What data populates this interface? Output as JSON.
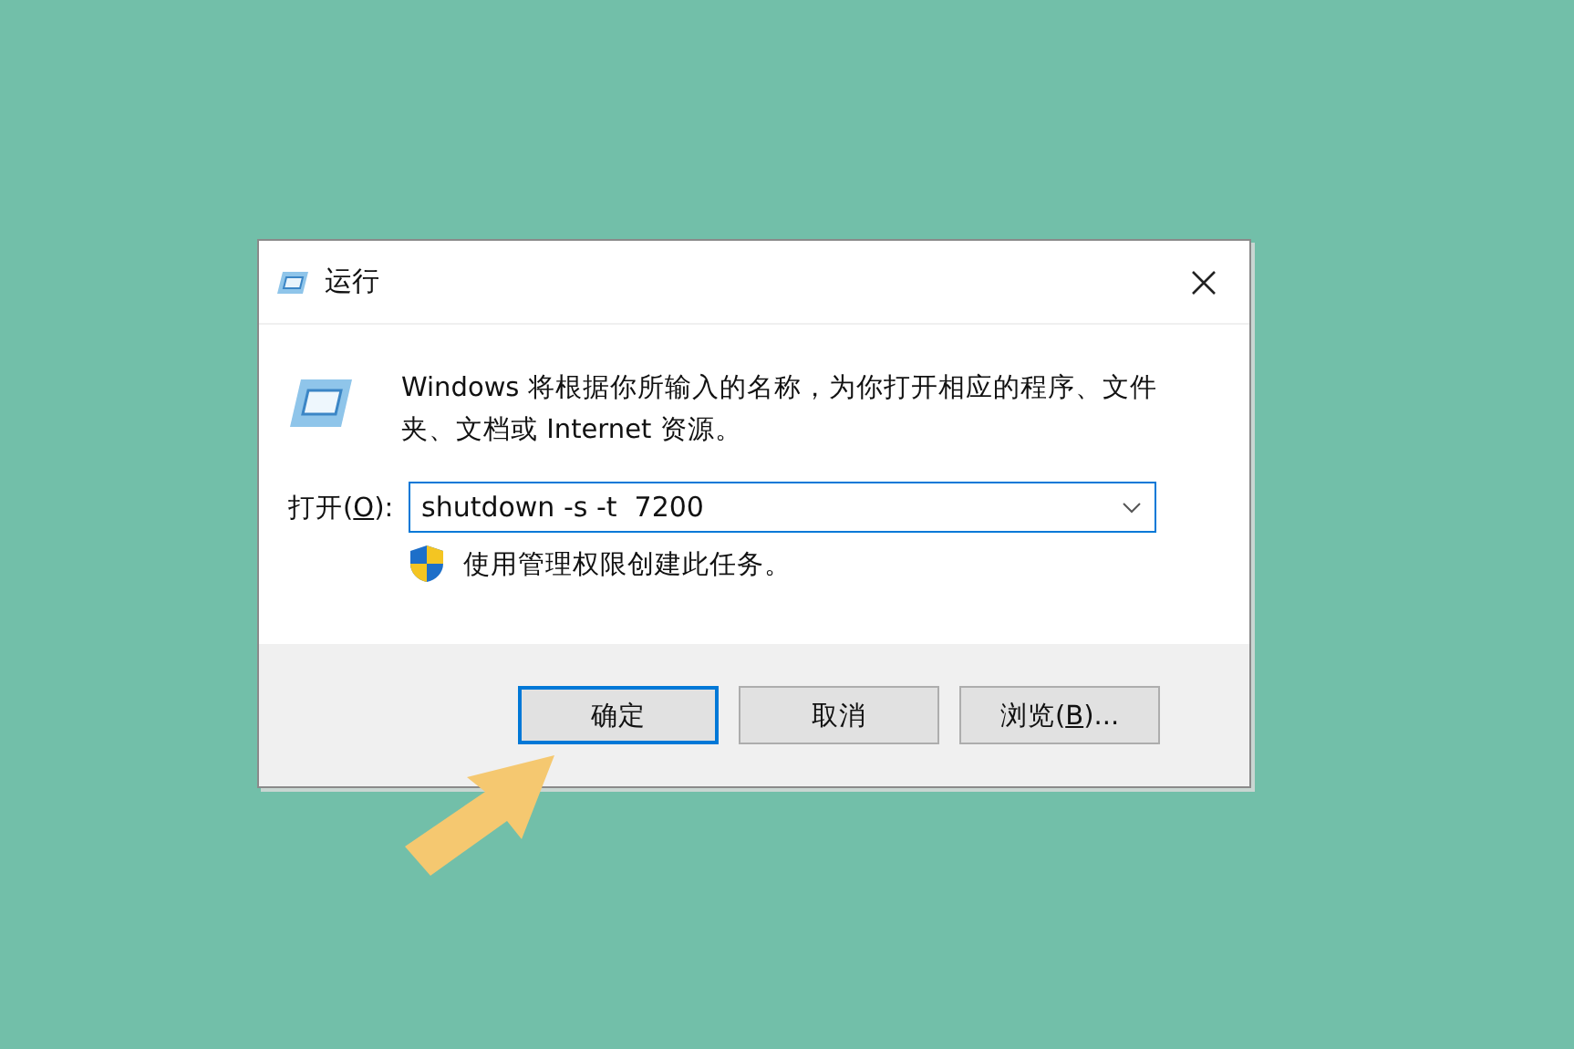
{
  "window": {
    "title": "运行"
  },
  "description": "Windows 将根据你所输入的名称，为你打开相应的程序、文件夹、文档或 Internet 资源。",
  "open_field": {
    "label": {
      "before": "打开(",
      "key": "O",
      "after": "):"
    },
    "value": "shutdown -s -t  7200",
    "focused": true
  },
  "admin_note": "使用管理权限创建此任务。",
  "buttons": [
    {
      "label": {
        "before": "确定"
      },
      "default": true
    },
    {
      "label": {
        "before": "取消"
      },
      "default": false
    },
    {
      "label": {
        "before": "浏览(",
        "key": "B",
        "after": ")..."
      },
      "default": false
    }
  ],
  "annotation": {
    "kind": "arrow"
  }
}
